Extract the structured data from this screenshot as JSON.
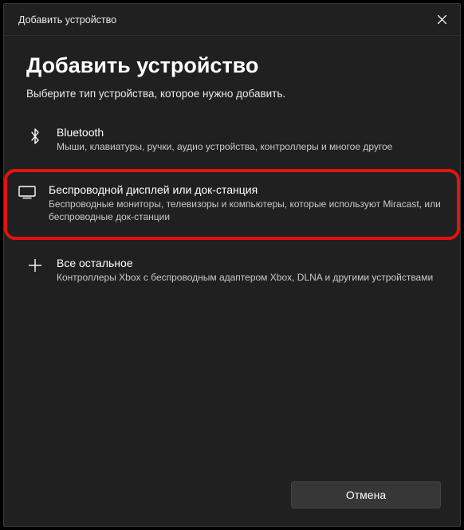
{
  "titlebar": {
    "title": "Добавить устройство"
  },
  "page": {
    "heading": "Добавить устройство",
    "subheading": "Выберите тип устройства, которое нужно добавить."
  },
  "options": [
    {
      "title": "Bluetooth",
      "desc": "Мыши, клавиатуры, ручки, аудио устройства, контроллеры и многое другое"
    },
    {
      "title": "Беспроводной дисплей или док-станция",
      "desc": "Беспроводные мониторы, телевизоры и компьютеры, которые используют Miracast, или беспроводные док-станции"
    },
    {
      "title": "Все остальное",
      "desc": "Контроллеры Xbox с беспроводным адаптером Xbox, DLNA и другими устройствами"
    }
  ],
  "footer": {
    "cancel": "Отмена"
  }
}
